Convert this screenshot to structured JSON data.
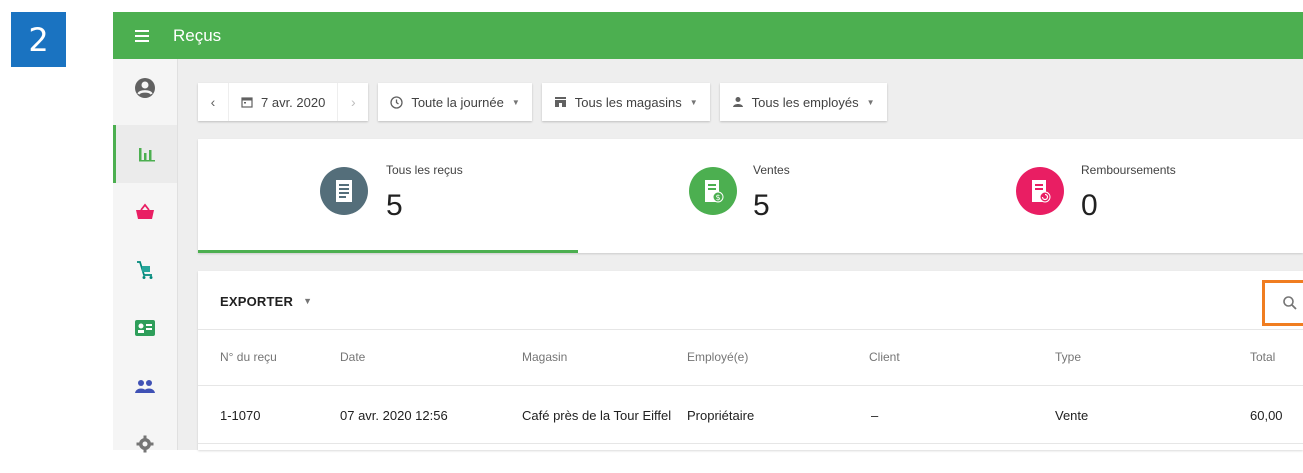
{
  "step": "2",
  "topbar": {
    "title": "Reçus"
  },
  "sidebar": {
    "items": [
      "account-icon",
      "reports-icon",
      "items-icon",
      "inventory-icon",
      "customers-icon",
      "employees-icon",
      "settings-icon"
    ]
  },
  "filters": {
    "date": "7 avr. 2020",
    "time": "Toute la journée",
    "stores": "Tous les magasins",
    "employees": "Tous les employés"
  },
  "summary": {
    "all": {
      "label": "Tous les reçus",
      "value": "5"
    },
    "sales": {
      "label": "Ventes",
      "value": "5"
    },
    "refunds": {
      "label": "Remboursements",
      "value": "0"
    }
  },
  "colors": {
    "green": "#4caf50",
    "slate": "#546e7a",
    "pink": "#e91e63",
    "orange": "#f07d20"
  },
  "table": {
    "export_label": "EXPORTER",
    "columns": [
      "N° du reçu",
      "Date",
      "Magasin",
      "Employé(e)",
      "Client",
      "Type",
      "Total"
    ],
    "rows": [
      [
        "1-1070",
        "07 avr. 2020 12:56",
        "Café près de la Tour Eiffel",
        "Propriétaire",
        "–",
        "Vente",
        "60,00"
      ]
    ]
  }
}
